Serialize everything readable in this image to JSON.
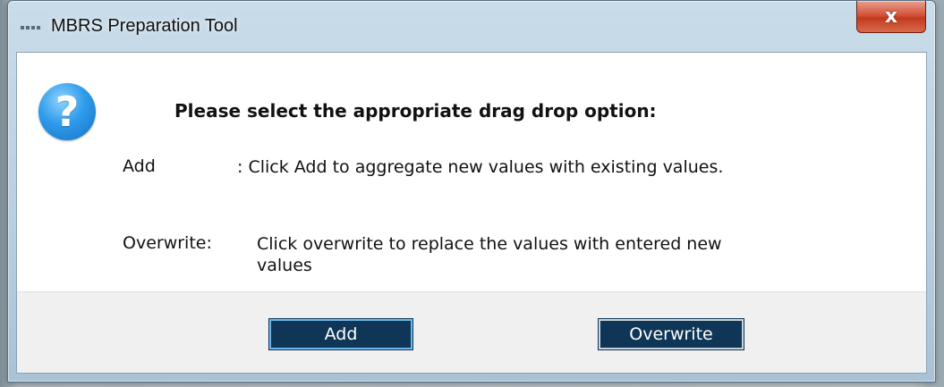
{
  "window": {
    "title": "MBRS Preparation Tool",
    "close_label": "x"
  },
  "dialog": {
    "icon": "question-icon",
    "icon_glyph": "?",
    "heading": "Please select the appropriate drag drop option:",
    "options": [
      {
        "label": "Add",
        "description": ": Click Add to aggregate new values with existing values."
      },
      {
        "label": "Overwrite:",
        "description_line1": "Click overwrite to replace the values with entered new",
        "description_line2": "values"
      }
    ]
  },
  "buttons": {
    "add": "Add",
    "overwrite": "Overwrite"
  },
  "colors": {
    "button_bg": "#0f3656",
    "icon_blue": "#2f9bea",
    "close_red": "#d4533a"
  }
}
